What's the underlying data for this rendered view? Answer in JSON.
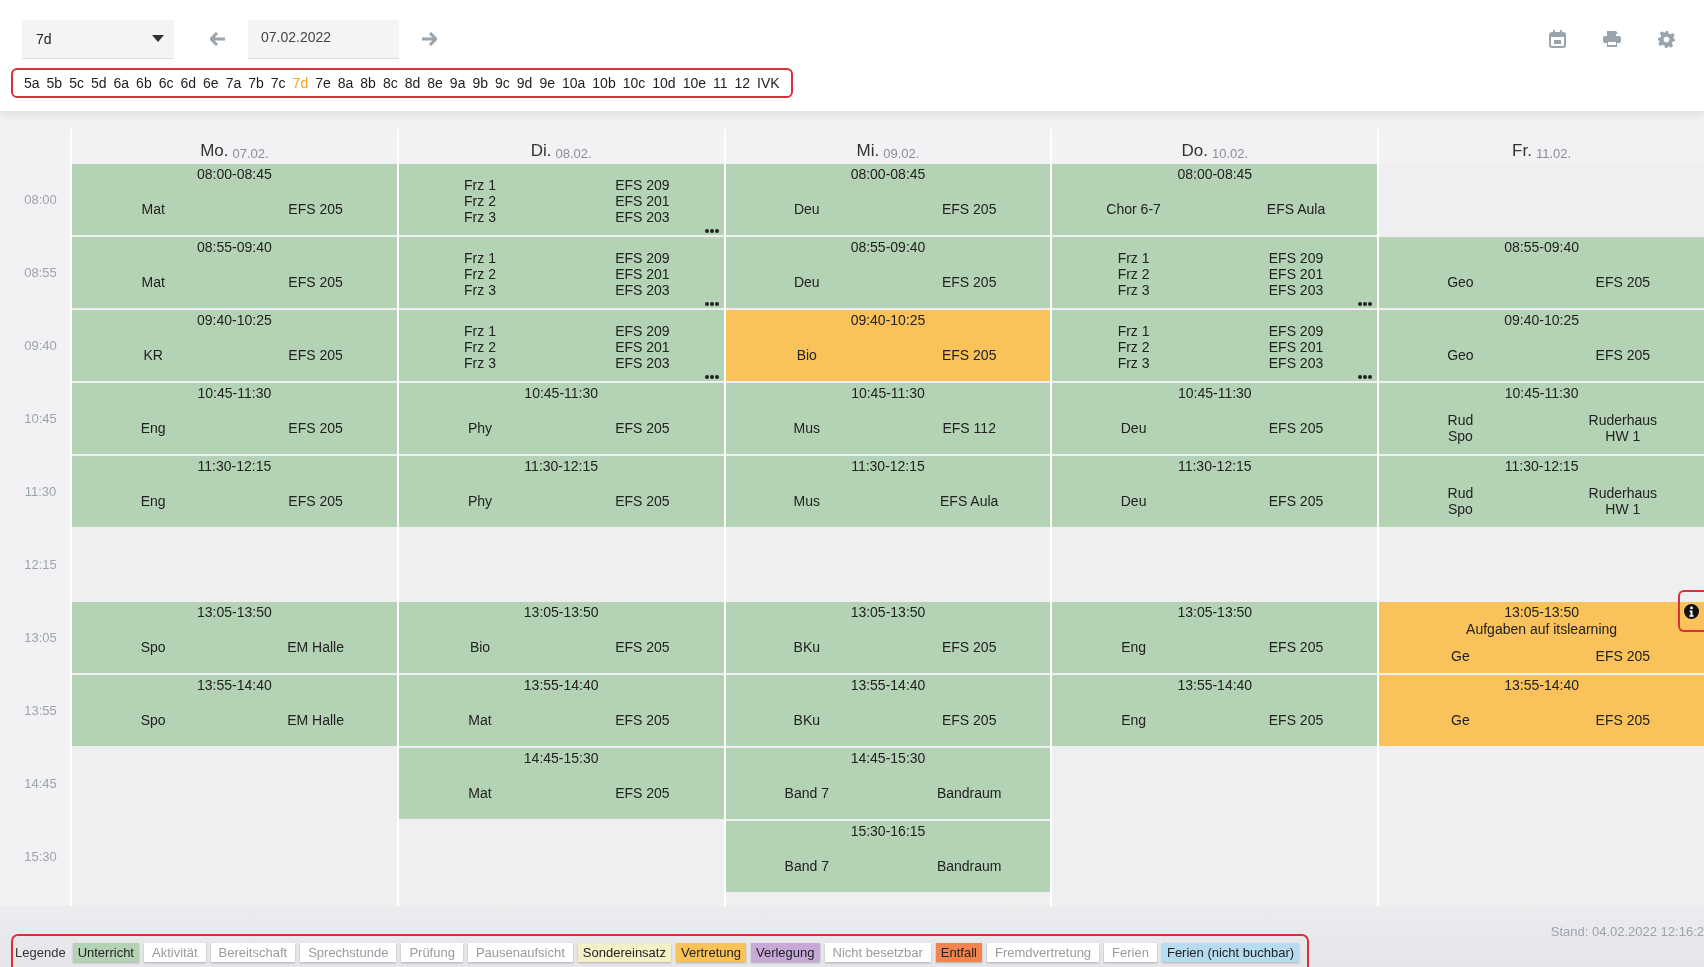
{
  "toolbar": {
    "class_select": {
      "value": "7d"
    },
    "date_field": {
      "value": "07.02.2022"
    }
  },
  "classes": [
    {
      "label": "5a",
      "selected": false
    },
    {
      "label": "5b",
      "selected": false
    },
    {
      "label": "5c",
      "selected": false
    },
    {
      "label": "5d",
      "selected": false
    },
    {
      "label": "6a",
      "selected": false
    },
    {
      "label": "6b",
      "selected": false
    },
    {
      "label": "6c",
      "selected": false
    },
    {
      "label": "6d",
      "selected": false
    },
    {
      "label": "6e",
      "selected": false
    },
    {
      "label": "7a",
      "selected": false
    },
    {
      "label": "7b",
      "selected": false
    },
    {
      "label": "7c",
      "selected": false
    },
    {
      "label": "7d",
      "selected": true
    },
    {
      "label": "7e",
      "selected": false
    },
    {
      "label": "8a",
      "selected": false
    },
    {
      "label": "8b",
      "selected": false
    },
    {
      "label": "8c",
      "selected": false
    },
    {
      "label": "8d",
      "selected": false
    },
    {
      "label": "8e",
      "selected": false
    },
    {
      "label": "9a",
      "selected": false
    },
    {
      "label": "9b",
      "selected": false
    },
    {
      "label": "9c",
      "selected": false
    },
    {
      "label": "9d",
      "selected": false
    },
    {
      "label": "9e",
      "selected": false
    },
    {
      "label": "10a",
      "selected": false
    },
    {
      "label": "10b",
      "selected": false
    },
    {
      "label": "10c",
      "selected": false
    },
    {
      "label": "10d",
      "selected": false
    },
    {
      "label": "10e",
      "selected": false
    },
    {
      "label": "11",
      "selected": false
    },
    {
      "label": "12",
      "selected": false
    },
    {
      "label": "IVK",
      "selected": false
    }
  ],
  "times": [
    "08:00",
    "08:55",
    "09:40",
    "10:45",
    "11:30",
    "12:15",
    "13:05",
    "13:55",
    "14:45",
    "15:30"
  ],
  "days": [
    {
      "name": "Mo.",
      "date": "07.02.",
      "slots": [
        {
          "kind": "lesson",
          "substitution": false,
          "time": "08:00-08:45",
          "entries": [
            {
              "subject": "Mat",
              "room": "EFS 205"
            }
          ]
        },
        {
          "kind": "lesson",
          "substitution": false,
          "time": "08:55-09:40",
          "entries": [
            {
              "subject": "Mat",
              "room": "EFS 205"
            }
          ]
        },
        {
          "kind": "lesson",
          "substitution": false,
          "time": "09:40-10:25",
          "entries": [
            {
              "subject": "KR",
              "room": "EFS 205"
            }
          ]
        },
        {
          "kind": "lesson",
          "substitution": false,
          "time": "10:45-11:30",
          "entries": [
            {
              "subject": "Eng",
              "room": "EFS 205"
            }
          ]
        },
        {
          "kind": "lesson",
          "substitution": false,
          "time": "11:30-12:15",
          "entries": [
            {
              "subject": "Eng",
              "room": "EFS 205"
            }
          ]
        },
        {
          "kind": "empty"
        },
        {
          "kind": "lesson",
          "substitution": false,
          "time": "13:05-13:50",
          "entries": [
            {
              "subject": "Spo",
              "room": "EM Halle"
            }
          ]
        },
        {
          "kind": "lesson",
          "substitution": false,
          "time": "13:55-14:40",
          "entries": [
            {
              "subject": "Spo",
              "room": "EM Halle"
            }
          ]
        },
        {
          "kind": "empty"
        },
        {
          "kind": "empty"
        }
      ]
    },
    {
      "name": "Di.",
      "date": "08.02.",
      "slots": [
        {
          "kind": "lesson",
          "substitution": false,
          "more": true,
          "entries": [
            {
              "subject": "Frz 1",
              "room": "EFS 209"
            },
            {
              "subject": "Frz 2",
              "room": "EFS 201"
            },
            {
              "subject": "Frz 3",
              "room": "EFS 203"
            }
          ]
        },
        {
          "kind": "lesson",
          "substitution": false,
          "more": true,
          "entries": [
            {
              "subject": "Frz 1",
              "room": "EFS 209"
            },
            {
              "subject": "Frz 2",
              "room": "EFS 201"
            },
            {
              "subject": "Frz 3",
              "room": "EFS 203"
            }
          ]
        },
        {
          "kind": "lesson",
          "substitution": false,
          "more": true,
          "entries": [
            {
              "subject": "Frz 1",
              "room": "EFS 209"
            },
            {
              "subject": "Frz 2",
              "room": "EFS 201"
            },
            {
              "subject": "Frz 3",
              "room": "EFS 203"
            }
          ]
        },
        {
          "kind": "lesson",
          "substitution": false,
          "time": "10:45-11:30",
          "entries": [
            {
              "subject": "Phy",
              "room": "EFS 205"
            }
          ]
        },
        {
          "kind": "lesson",
          "substitution": false,
          "time": "11:30-12:15",
          "entries": [
            {
              "subject": "Phy",
              "room": "EFS 205"
            }
          ]
        },
        {
          "kind": "empty"
        },
        {
          "kind": "lesson",
          "substitution": false,
          "time": "13:05-13:50",
          "entries": [
            {
              "subject": "Bio",
              "room": "EFS 205"
            }
          ]
        },
        {
          "kind": "lesson",
          "substitution": false,
          "time": "13:55-14:40",
          "entries": [
            {
              "subject": "Mat",
              "room": "EFS 205"
            }
          ]
        },
        {
          "kind": "lesson",
          "substitution": false,
          "time": "14:45-15:30",
          "entries": [
            {
              "subject": "Mat",
              "room": "EFS 205"
            }
          ]
        },
        {
          "kind": "empty"
        }
      ]
    },
    {
      "name": "Mi.",
      "date": "09.02.",
      "slots": [
        {
          "kind": "lesson",
          "substitution": false,
          "time": "08:00-08:45",
          "entries": [
            {
              "subject": "Deu",
              "room": "EFS 205"
            }
          ]
        },
        {
          "kind": "lesson",
          "substitution": false,
          "time": "08:55-09:40",
          "entries": [
            {
              "subject": "Deu",
              "room": "EFS 205"
            }
          ]
        },
        {
          "kind": "lesson",
          "substitution": true,
          "time": "09:40-10:25",
          "entries": [
            {
              "subject": "Bio",
              "room": "EFS 205"
            }
          ]
        },
        {
          "kind": "lesson",
          "substitution": false,
          "time": "10:45-11:30",
          "entries": [
            {
              "subject": "Mus",
              "room": "EFS 112"
            }
          ]
        },
        {
          "kind": "lesson",
          "substitution": false,
          "time": "11:30-12:15",
          "entries": [
            {
              "subject": "Mus",
              "room": "EFS Aula"
            }
          ]
        },
        {
          "kind": "empty"
        },
        {
          "kind": "lesson",
          "substitution": false,
          "time": "13:05-13:50",
          "entries": [
            {
              "subject": "BKu",
              "room": "EFS 205"
            }
          ]
        },
        {
          "kind": "lesson",
          "substitution": false,
          "time": "13:55-14:40",
          "entries": [
            {
              "subject": "BKu",
              "room": "EFS 205"
            }
          ]
        },
        {
          "kind": "lesson",
          "substitution": false,
          "time": "14:45-15:30",
          "entries": [
            {
              "subject": "Band 7",
              "room": "Bandraum"
            }
          ]
        },
        {
          "kind": "lesson",
          "substitution": false,
          "time": "15:30-16:15",
          "entries": [
            {
              "subject": "Band 7",
              "room": "Bandraum"
            }
          ]
        }
      ]
    },
    {
      "name": "Do.",
      "date": "10.02.",
      "slots": [
        {
          "kind": "lesson",
          "substitution": false,
          "time": "08:00-08:45",
          "entries": [
            {
              "subject": "Chor 6-7",
              "room": "EFS Aula"
            }
          ]
        },
        {
          "kind": "lesson",
          "substitution": false,
          "more": true,
          "entries": [
            {
              "subject": "Frz 1",
              "room": "EFS 209"
            },
            {
              "subject": "Frz 2",
              "room": "EFS 201"
            },
            {
              "subject": "Frz 3",
              "room": "EFS 203"
            }
          ]
        },
        {
          "kind": "lesson",
          "substitution": false,
          "more": true,
          "entries": [
            {
              "subject": "Frz 1",
              "room": "EFS 209"
            },
            {
              "subject": "Frz 2",
              "room": "EFS 201"
            },
            {
              "subject": "Frz 3",
              "room": "EFS 203"
            }
          ]
        },
        {
          "kind": "lesson",
          "substitution": false,
          "time": "10:45-11:30",
          "entries": [
            {
              "subject": "Deu",
              "room": "EFS 205"
            }
          ]
        },
        {
          "kind": "lesson",
          "substitution": false,
          "time": "11:30-12:15",
          "entries": [
            {
              "subject": "Deu",
              "room": "EFS 205"
            }
          ]
        },
        {
          "kind": "empty"
        },
        {
          "kind": "lesson",
          "substitution": false,
          "time": "13:05-13:50",
          "entries": [
            {
              "subject": "Eng",
              "room": "EFS 205"
            }
          ]
        },
        {
          "kind": "lesson",
          "substitution": false,
          "time": "13:55-14:40",
          "entries": [
            {
              "subject": "Eng",
              "room": "EFS 205"
            }
          ]
        },
        {
          "kind": "empty"
        },
        {
          "kind": "empty"
        }
      ]
    },
    {
      "name": "Fr.",
      "date": "11.02.",
      "slots": [
        {
          "kind": "empty"
        },
        {
          "kind": "lesson",
          "substitution": false,
          "time": "08:55-09:40",
          "entries": [
            {
              "subject": "Geo",
              "room": "EFS 205"
            }
          ]
        },
        {
          "kind": "lesson",
          "substitution": false,
          "time": "09:40-10:25",
          "entries": [
            {
              "subject": "Geo",
              "room": "EFS 205"
            }
          ]
        },
        {
          "kind": "lesson",
          "substitution": false,
          "time": "10:45-11:30",
          "entries": [
            {
              "subject": "Rud",
              "room": "Ruderhaus"
            },
            {
              "subject": "Spo",
              "room": "HW 1"
            }
          ]
        },
        {
          "kind": "lesson",
          "substitution": false,
          "time": "11:30-12:15",
          "entries": [
            {
              "subject": "Rud",
              "room": "Ruderhaus"
            },
            {
              "subject": "Spo",
              "room": "HW 1"
            }
          ]
        },
        {
          "kind": "empty"
        },
        {
          "kind": "lesson",
          "substitution": true,
          "time": "13:05-13:50",
          "note": "Aufgaben auf itslearning",
          "info": true,
          "entries": [
            {
              "subject": "Ge",
              "room": "EFS 205"
            }
          ]
        },
        {
          "kind": "lesson",
          "substitution": true,
          "time": "13:55-14:40",
          "entries": [
            {
              "subject": "Ge",
              "room": "EFS 205"
            }
          ]
        },
        {
          "kind": "empty"
        },
        {
          "kind": "empty"
        }
      ]
    }
  ],
  "legend": {
    "title": "Legende",
    "items": [
      {
        "label": "Unterricht",
        "color": "#b4d2b4"
      },
      {
        "label": "Aktivität",
        "color": "#ffffff"
      },
      {
        "label": "Bereitschaft",
        "color": "#ffffff"
      },
      {
        "label": "Sprechstunde",
        "color": "#ffffff"
      },
      {
        "label": "Prüfung",
        "color": "#ffffff"
      },
      {
        "label": "Pausenaufsicht",
        "color": "#ffffff"
      },
      {
        "label": "Sondereinsatz",
        "color": "#f4f0c8"
      },
      {
        "label": "Vertretung",
        "color": "#f9c25b"
      },
      {
        "label": "Verlegung",
        "color": "#c7a9d7"
      },
      {
        "label": "Nicht besetzbar",
        "color": "#ffffff"
      },
      {
        "label": "Entfall",
        "color": "#f2844f"
      },
      {
        "label": "Fremdvertretung",
        "color": "#ffffff"
      },
      {
        "label": "Ferien",
        "color": "#ffffff"
      },
      {
        "label": "Ferien (nicht buchbar)",
        "color": "#b8dcef"
      }
    ]
  },
  "stand": "Stand: 04.02.2022 12:16:2"
}
